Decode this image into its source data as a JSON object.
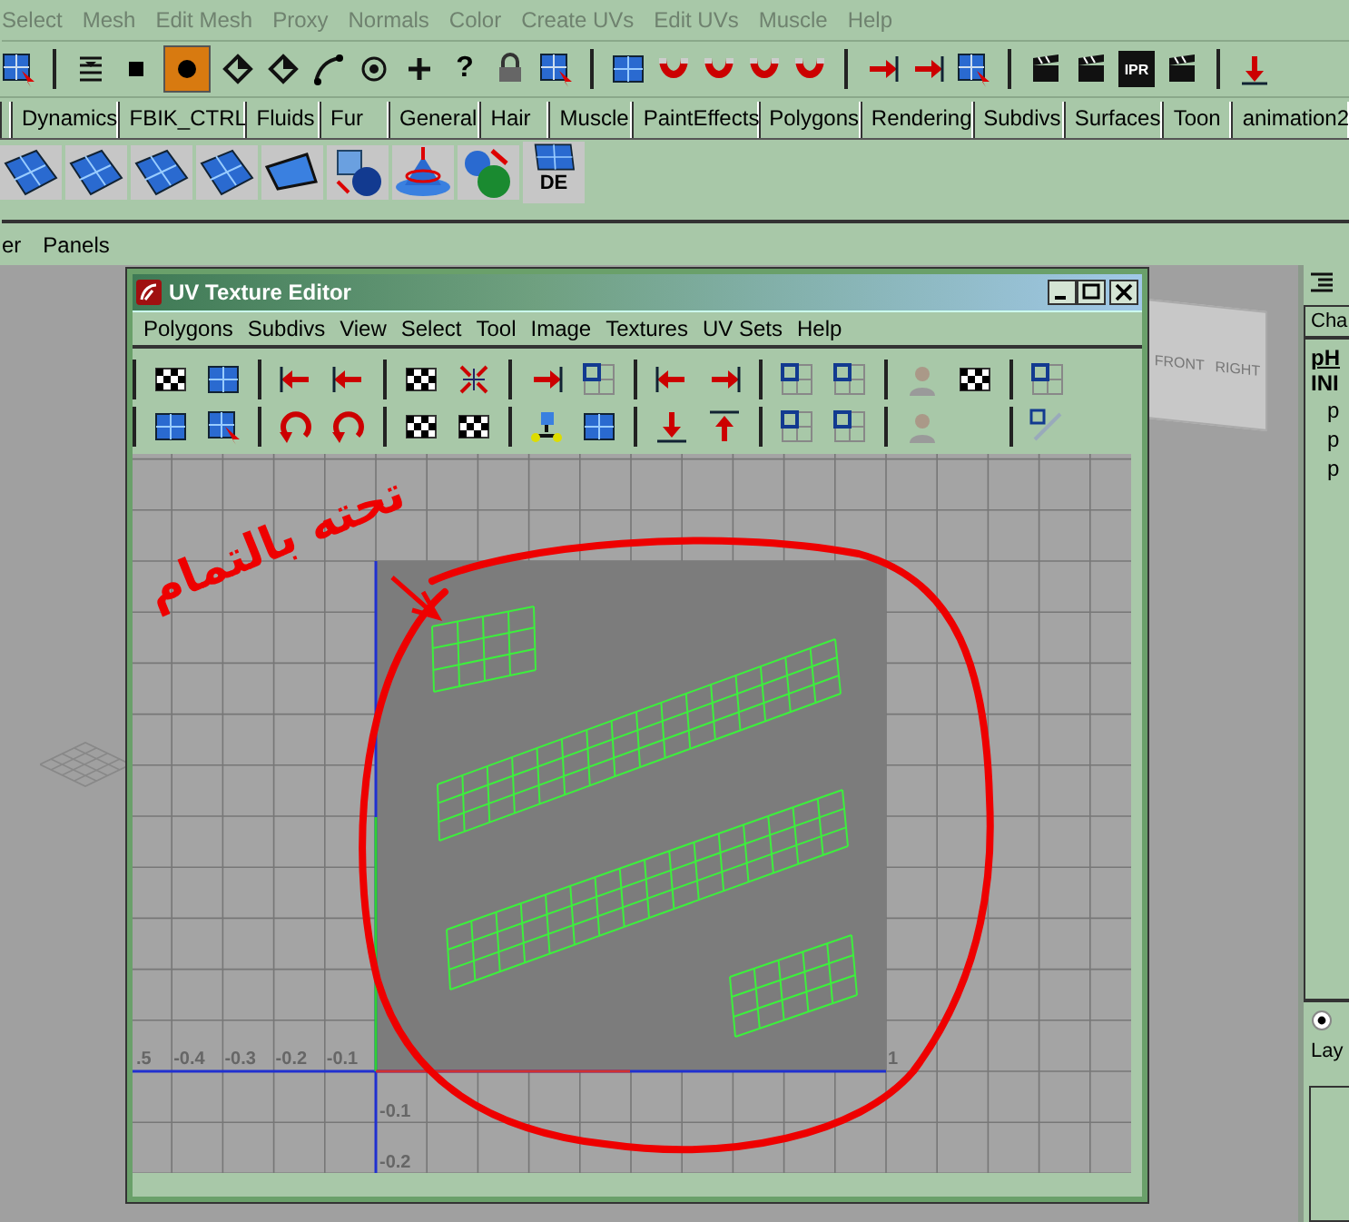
{
  "main_menu": [
    "Select",
    "Mesh",
    "Edit Mesh",
    "Proxy",
    "Normals",
    "Color",
    "Create UVs",
    "Edit UVs",
    "Muscle",
    "Help"
  ],
  "toolbar_glyphs": {
    "help": "?",
    "render_ipr": "IPR"
  },
  "shelf_tabs": [
    "Dynamics",
    "FBIK_CTRL",
    "Fluids",
    "Fur",
    "General",
    "Hair",
    "Muscle",
    "PaintEffects",
    "Polygons",
    "Rendering",
    "Subdivs",
    "Surfaces",
    "Toon",
    "animation2"
  ],
  "shelf_icon_label": "DE",
  "panel_menu": [
    "er",
    "Panels"
  ],
  "uv_editor": {
    "title": "UV Texture Editor",
    "menu": [
      "Polygons",
      "Subdivs",
      "View",
      "Select",
      "Tool",
      "Image",
      "Textures",
      "UV Sets",
      "Help"
    ],
    "x_labels": [
      ".5",
      "-0.4",
      "-0.3",
      "-0.2",
      "-0.1"
    ],
    "x_end_label": "1",
    "y_labels": [
      "-0.1",
      "-0.2"
    ],
    "annotation": "تحته بالتمام"
  },
  "view_cube": {
    "faces": [
      "FRONT",
      "RIGHT"
    ]
  },
  "right_panel": {
    "tab": "Cha",
    "node": "pH",
    "section": "INI",
    "items": [
      "p",
      "p",
      "p"
    ],
    "layer_tab": "Lay",
    "radio_selected": true
  }
}
